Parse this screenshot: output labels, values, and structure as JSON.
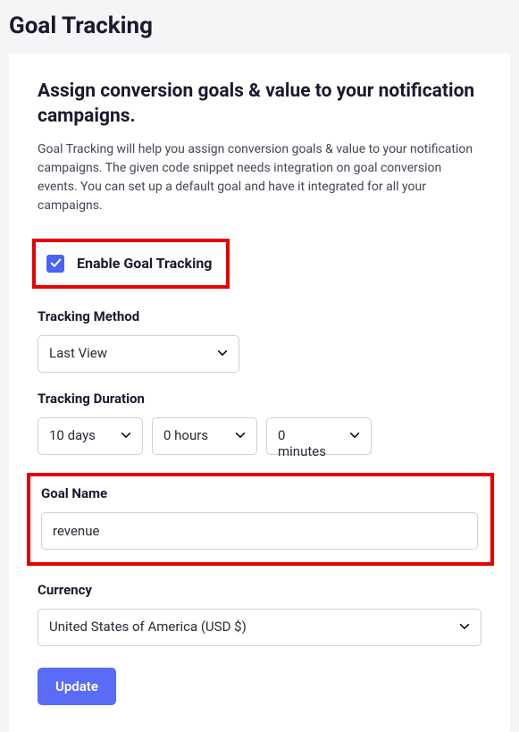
{
  "page_title": "Goal Tracking",
  "card": {
    "heading": "Assign conversion goals & value to your notification campaigns.",
    "description": "Goal Tracking will help you assign conversion goals & value to your notification campaigns. The given code snippet needs integration on goal conversion events. You can set up a default goal and have it integrated for all your campaigns."
  },
  "enable": {
    "checked": true,
    "label": "Enable Goal Tracking"
  },
  "tracking_method": {
    "label": "Tracking Method",
    "value": "Last View"
  },
  "tracking_duration": {
    "label": "Tracking Duration",
    "days": "10 days",
    "hours": "0 hours",
    "minutes": "0 minutes"
  },
  "goal_name": {
    "label": "Goal Name",
    "value": "revenue"
  },
  "currency": {
    "label": "Currency",
    "value": "United States of America (USD $)"
  },
  "update_button": "Update"
}
